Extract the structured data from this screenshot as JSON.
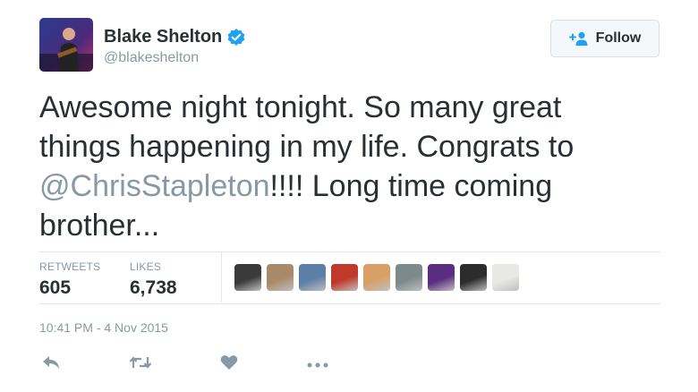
{
  "header": {
    "display_name": "Blake Shelton",
    "handle": "@blakeshelton",
    "verified": true,
    "follow_label": "Follow"
  },
  "tweet": {
    "text_before": "Awesome night tonight. So many great things happening in my life. Congrats to ",
    "mention": "@ChrisStapleton",
    "text_after": "!!!! Long time coming brother..."
  },
  "stats": {
    "retweets_label": "RETWEETS",
    "retweets_count": "605",
    "likes_label": "LIKES",
    "likes_count": "6,738"
  },
  "likers": [
    {
      "icon": "liker-avatar-1",
      "color": "#3a3a3a"
    },
    {
      "icon": "liker-avatar-2",
      "color": "#a88a6a"
    },
    {
      "icon": "liker-avatar-3",
      "color": "#5b7fa6"
    },
    {
      "icon": "liker-avatar-4",
      "color": "#c0392b"
    },
    {
      "icon": "liker-avatar-5",
      "color": "#d9a066"
    },
    {
      "icon": "liker-avatar-6",
      "color": "#7d8a8c"
    },
    {
      "icon": "liker-avatar-7",
      "color": "#5a2d82"
    },
    {
      "icon": "liker-avatar-8",
      "color": "#2c2c2c"
    },
    {
      "icon": "liker-avatar-9",
      "color": "#e8e8e4"
    }
  ],
  "timestamp": "10:41 PM - 4 Nov 2015",
  "actions": [
    "reply-icon",
    "retweet-icon",
    "like-icon",
    "more-icon"
  ],
  "colors": {
    "text": "#292f33",
    "muted": "#8899a6",
    "accent": "#1da1f2",
    "border": "#e1e8ed"
  }
}
